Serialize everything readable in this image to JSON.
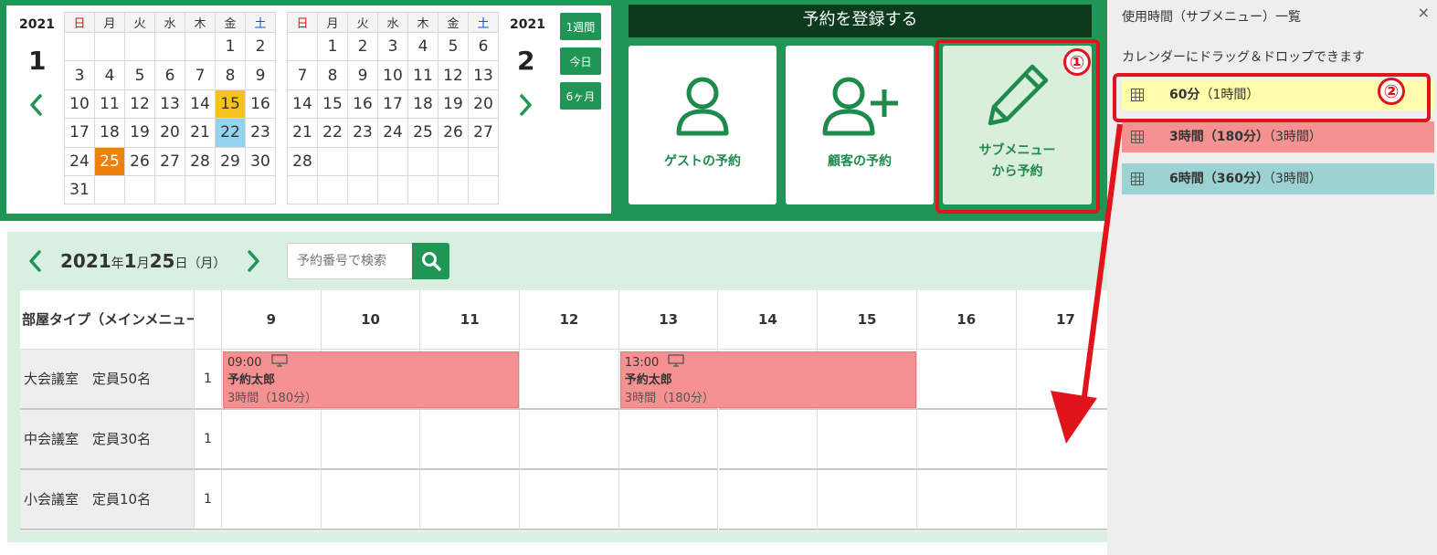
{
  "calendar": {
    "weekdays": [
      "日",
      "月",
      "火",
      "水",
      "木",
      "金",
      "土"
    ],
    "jan": {
      "year": "2021",
      "month": "1",
      "rows": [
        [
          "",
          "",
          "",
          "",
          "",
          "1",
          "2"
        ],
        [
          "3",
          "4",
          "5",
          "6",
          "7",
          "8",
          "9"
        ],
        [
          "10",
          "11",
          "12",
          "13",
          "14",
          "15",
          "16"
        ],
        [
          "17",
          "18",
          "19",
          "20",
          "21",
          "22",
          "23"
        ],
        [
          "24",
          "25",
          "26",
          "27",
          "28",
          "29",
          "30"
        ],
        [
          "31",
          "",
          "",
          "",
          "",
          "",
          ""
        ]
      ],
      "today": "15",
      "selected": "22",
      "current": "25"
    },
    "feb": {
      "year": "2021",
      "month": "2",
      "rows": [
        [
          "",
          "1",
          "2",
          "3",
          "4",
          "5",
          "6"
        ],
        [
          "7",
          "8",
          "9",
          "10",
          "11",
          "12",
          "13"
        ],
        [
          "14",
          "15",
          "16",
          "17",
          "18",
          "19",
          "20"
        ],
        [
          "21",
          "22",
          "23",
          "24",
          "25",
          "26",
          "27"
        ],
        [
          "28",
          "",
          "",
          "",
          "",
          "",
          ""
        ],
        [
          "",
          "",
          "",
          "",
          "",
          "",
          ""
        ]
      ]
    },
    "range_buttons": [
      "1週間",
      "今日",
      "6ヶ月"
    ]
  },
  "register": {
    "title": "予約を登録する",
    "guest_label": "ゲストの予約",
    "customer_label": "顧客の予約",
    "submenu_label_line1": "サブメニュー",
    "submenu_label_line2": "から予約"
  },
  "annotations": {
    "badge1": "①",
    "badge2": "②"
  },
  "schedule": {
    "date_year": "2021",
    "date_year_unit": "年",
    "date_month": "1",
    "date_month_unit": "月",
    "date_day": "25",
    "date_day_unit": "日",
    "date_weekday": "（月）",
    "search_placeholder": "予約番号で検索",
    "room_header": "部屋タイプ（メインメニュー）",
    "hours": [
      "9",
      "10",
      "11",
      "12",
      "13",
      "14",
      "15",
      "16",
      "17"
    ],
    "rooms": [
      {
        "name": "大会議室　定員50名",
        "count": "1"
      },
      {
        "name": "中会議室　定員30名",
        "count": "1"
      },
      {
        "name": "小会議室　定員10名",
        "count": "1"
      }
    ],
    "bookings": [
      {
        "time": "09:00",
        "name": "予約太郎",
        "duration": "3時間（180分）"
      },
      {
        "time": "13:00",
        "name": "予約太郎",
        "duration": "3時間（180分）"
      }
    ]
  },
  "side_panel": {
    "title": "使用時間（サブメニュー）一覧",
    "close": "×",
    "hint": "カレンダーにドラッグ＆ドロップできます",
    "items": [
      {
        "bold": "60分",
        "normal": "（1時間）",
        "color": "#fdfdab"
      },
      {
        "bold": "3時間（180分）",
        "normal": "（3時間）",
        "color": "#f69192"
      },
      {
        "bold": "6時間（360分）",
        "normal": "（3時間）",
        "color": "#9dd2d2"
      }
    ]
  },
  "colors": {
    "green": "#1f9655",
    "dark_green": "#0b3a1d",
    "highlight_red": "#e0141a",
    "booking_pink": "#f69192"
  }
}
